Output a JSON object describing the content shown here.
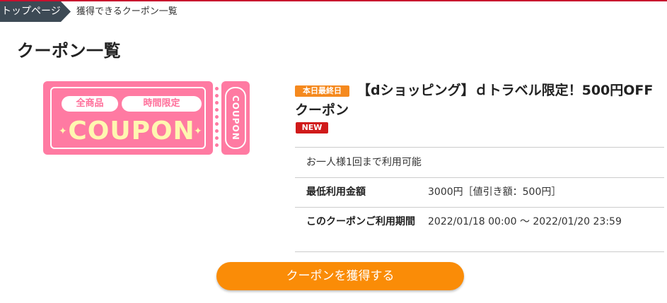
{
  "breadcrumb": {
    "home": "トップページ",
    "current": "獲得できるクーポン一覧"
  },
  "page": {
    "title": "クーポン一覧"
  },
  "coupon": {
    "image": {
      "tag1": "全商品",
      "tag2": "時間限定",
      "word": "COUPON",
      "stub": "COUPON",
      "colors": {
        "ticket": "#ff7aa2",
        "word": "#fff7b0"
      }
    },
    "badge_lastday": "本日最終日",
    "title": "【dショッピング】ｄトラベル限定！500円OFFクーポン",
    "badge_new": "NEW",
    "note": "お一人様1回まで利用可能",
    "min_amount_label": "最低利用金額",
    "min_amount_value": "3000円［値引き額：500円］",
    "period_label": "このクーポンご利用期間",
    "period_value": "2022/01/18 00:00 〜 2022/01/20 23:59",
    "get_button": "クーポンを獲得する",
    "colors": {
      "button": "#fa8c07",
      "badge_lastday": "#f5891e",
      "badge_new": "#d01a1a"
    }
  }
}
